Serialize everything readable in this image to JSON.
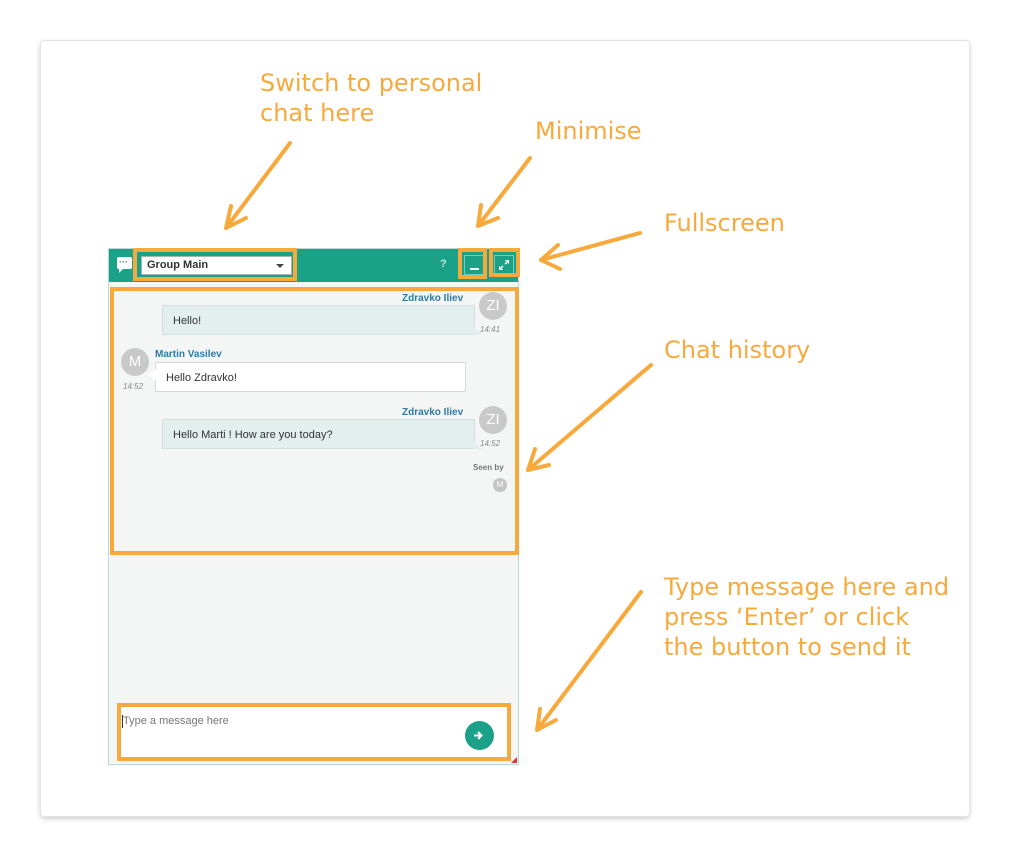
{
  "widget": {
    "chat_icon": "chat-bubble-icon",
    "chat_selector": {
      "value": "Group Main"
    },
    "help_label": "?",
    "minimize_icon": "minimize-icon",
    "fullscreen_icon": "expand-icon"
  },
  "messages": [
    {
      "author": "Zdravko Iliev",
      "initials": "ZI",
      "text": "Hello!",
      "time": "14:41",
      "direction": "out"
    },
    {
      "author": "Martin Vasilev",
      "initials": "M",
      "text": "Hello Zdravko!",
      "time": "14:52",
      "direction": "in"
    },
    {
      "author": "Zdravko Iliev",
      "initials": "ZI",
      "text": "Hello Marti ! How are you today?",
      "time": "14:52",
      "direction": "out"
    }
  ],
  "seen": {
    "label": "Seen by",
    "initial": "M"
  },
  "composer": {
    "placeholder": "Type a message here",
    "send_icon": "arrow-right-icon"
  },
  "annotations": {
    "switch_chat": [
      "Switch to personal",
      "chat here"
    ],
    "minimise": "Minimise",
    "fullscreen": "Fullscreen",
    "history": "Chat history",
    "type_message": [
      "Type message here and",
      "press ‘Enter’ or click",
      "the button to send it"
    ]
  },
  "colors": {
    "header": "#1ba187",
    "annotation": "#f8a93c",
    "author": "#2e7aa7"
  }
}
